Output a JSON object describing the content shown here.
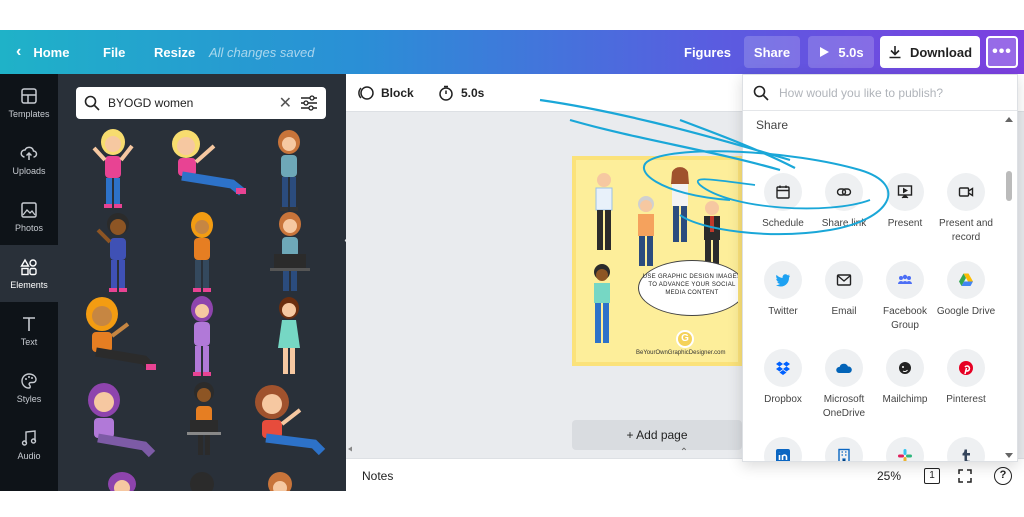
{
  "topbar": {
    "home_label": "Home",
    "file_label": "File",
    "resize_label": "Resize",
    "saved_status": "All changes saved",
    "figures_label": "Figures",
    "share_label": "Share",
    "play_duration": "5.0s",
    "download_label": "Download"
  },
  "rail": {
    "items": [
      {
        "label": "Templates",
        "icon": "layout-icon"
      },
      {
        "label": "Uploads",
        "icon": "cloud-upload-icon"
      },
      {
        "label": "Photos",
        "icon": "image-icon"
      },
      {
        "label": "Elements",
        "icon": "shapes-icon",
        "active": true
      },
      {
        "label": "Text",
        "icon": "text-icon"
      },
      {
        "label": "Styles",
        "icon": "palette-icon"
      },
      {
        "label": "Audio",
        "icon": "music-icon"
      }
    ]
  },
  "panel": {
    "search_value": "BYOGD women"
  },
  "toolbar": {
    "block_label": "Block",
    "duration_label": "5.0s"
  },
  "design": {
    "bubble_text": "USE GRAPHIC DESIGN IMAGES TO ADVANCE YOUR SOCIAL MEDIA CONTENT",
    "logo_letter": "G",
    "url_text": "BeYourOwnGraphicDesigner.com"
  },
  "add_page_label": "+ Add page",
  "footer": {
    "notes_label": "Notes",
    "zoom_percent": "25%",
    "page_count": "1",
    "zoom_level": 0.0
  },
  "share_menu": {
    "search_placeholder": "How would you like to publish?",
    "heading": "Share",
    "options": [
      {
        "label": "Schedule",
        "icon": "calendar-icon"
      },
      {
        "label": "Share link",
        "icon": "link-icon"
      },
      {
        "label": "Present",
        "icon": "present-icon"
      },
      {
        "label": "Present and record",
        "icon": "video-icon"
      },
      {
        "label": "Twitter",
        "icon": "twitter-icon"
      },
      {
        "label": "Email",
        "icon": "email-icon"
      },
      {
        "label": "Facebook Group",
        "icon": "group-icon"
      },
      {
        "label": "Google Drive",
        "icon": "google-drive-icon"
      },
      {
        "label": "Dropbox",
        "icon": "dropbox-icon"
      },
      {
        "label": "Microsoft OneDrive",
        "icon": "onedrive-icon"
      },
      {
        "label": "Mailchimp",
        "icon": "mailchimp-icon"
      },
      {
        "label": "Pinterest",
        "icon": "pinterest-icon"
      },
      {
        "label": "",
        "icon": "linkedin-icon"
      },
      {
        "label": "",
        "icon": "building-icon"
      },
      {
        "label": "",
        "icon": "slack-icon"
      },
      {
        "label": "",
        "icon": "tumblr-icon"
      }
    ]
  },
  "colors": {
    "accent_gradient_start": "#1fb2c8",
    "accent_gradient_end": "#7d3fe0",
    "rail_bg": "#0e1318",
    "panel_bg": "#293039",
    "annotation_blue": "#1aa7d8"
  }
}
